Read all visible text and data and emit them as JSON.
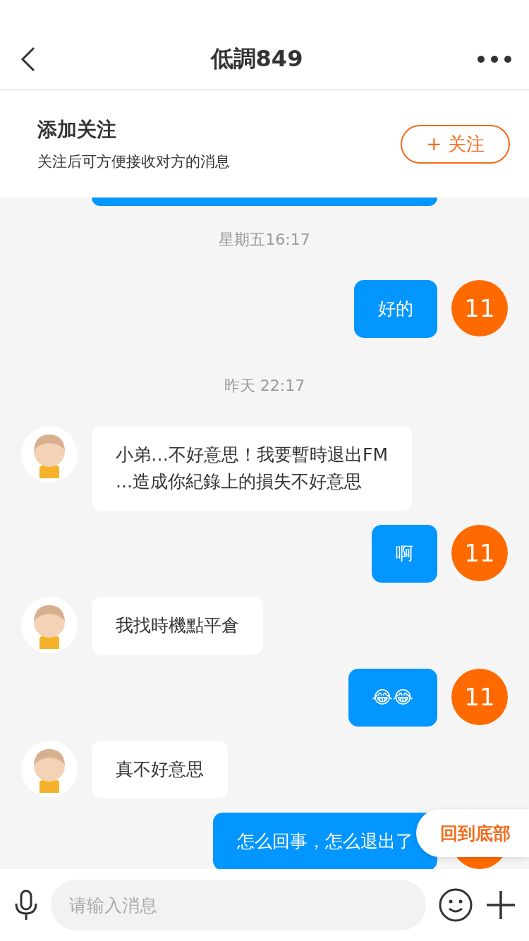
{
  "header": {
    "title": "低調849"
  },
  "follow_banner": {
    "title": "添加关注",
    "subtitle": "关注后可方便接收对方的消息",
    "button": "+ 关注"
  },
  "messages": [
    {
      "kind": "clipped"
    },
    {
      "kind": "time",
      "text": "星期五16:17"
    },
    {
      "kind": "out",
      "text": "好的",
      "avatar": "11"
    },
    {
      "kind": "time",
      "text": "昨天 22:17"
    },
    {
      "kind": "in",
      "text": "小弟…不好意思！我要暫時退出FM\n...造成你紀錄上的損失不好意思"
    },
    {
      "kind": "out",
      "text": "啊",
      "avatar": "11"
    },
    {
      "kind": "in",
      "text": "我找時機點平倉"
    },
    {
      "kind": "out",
      "text": "😂😂",
      "avatar": "11"
    },
    {
      "kind": "in",
      "text": "真不好意思"
    },
    {
      "kind": "out",
      "text": "怎么回事，怎么退出了"
    }
  ],
  "scroll_to_bottom": "回到底部",
  "input": {
    "placeholder": "请输入消息"
  }
}
